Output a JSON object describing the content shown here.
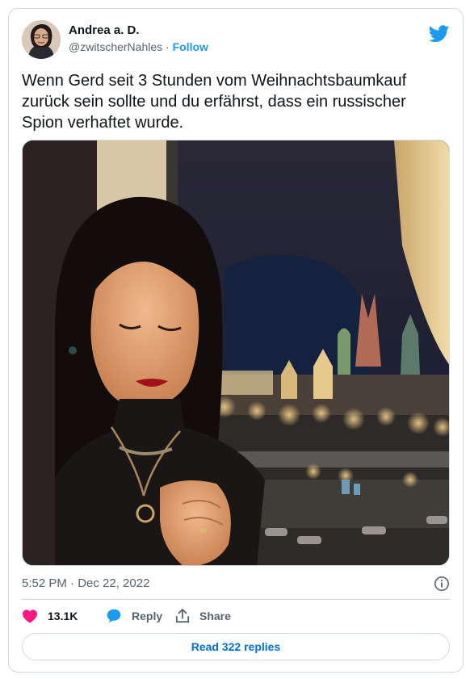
{
  "author": {
    "display_name": "Andrea a. D.",
    "handle": "@zwitscherNahles",
    "separator": "·",
    "follow_label": "Follow"
  },
  "tweet": {
    "text": "Wenn Gerd seit 3 Stunden vom Weihnachtsbaumkauf zurück sein sollte und du erfährst, dass ein russischer Spion verhaftet wurde.",
    "timestamp": "5:52 PM · Dec 22, 2022"
  },
  "actions": {
    "like_count": "13.1K",
    "reply_label": "Reply",
    "share_label": "Share",
    "read_replies_label": "Read 322 replies"
  },
  "icons": {
    "logo": "twitter-bird-icon",
    "info": "info-icon",
    "like": "heart-icon",
    "reply": "speech-bubble-icon",
    "share": "share-icon"
  },
  "colors": {
    "brand": "#1d9bf0",
    "like": "#f91880",
    "link": "#006fd6",
    "secondary_text": "#536471",
    "border": "#cfd9de"
  }
}
